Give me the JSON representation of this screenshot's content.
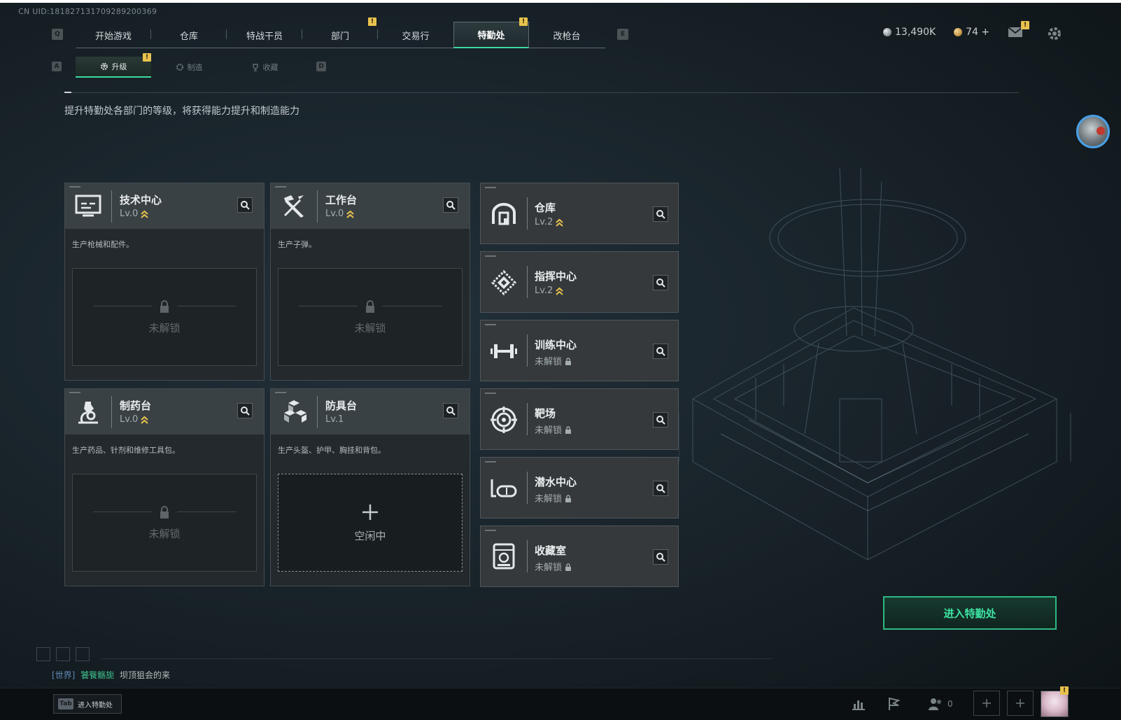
{
  "uid": "CN UID:181827131709289200369",
  "nav": {
    "key_left": "Q",
    "key_right": "E",
    "tabs": [
      "开始游戏",
      "仓库",
      "特战干员",
      "部门",
      "交易行",
      "特勤处",
      "改枪台"
    ],
    "active_tab": "特勤处",
    "alert_tabs": [
      "部门",
      "特勤处"
    ]
  },
  "subnav": {
    "key_left": "A",
    "key_right": "D",
    "tabs": [
      "升级",
      "制造",
      "收藏"
    ],
    "active_tab": "升级"
  },
  "currency": {
    "silver": "13,490K",
    "gold": "74 +",
    "silver_color": "#9aa3a7",
    "gold_color": "#c79a4a"
  },
  "description": "提升特勤处各部门的等级，将获得能力提升和制造能力",
  "facilities_left": [
    {
      "name": "技术中心",
      "level": "Lv.0",
      "upgradable": true,
      "desc": "生产枪械和配件。",
      "slot": "未解锁",
      "icon": "computer-icon"
    },
    {
      "name": "工作台",
      "level": "Lv.0",
      "upgradable": true,
      "desc": "生产子弹。",
      "slot": "未解锁",
      "icon": "tools-icon"
    },
    {
      "name": "制药台",
      "level": "Lv.0",
      "upgradable": true,
      "desc": "生产药品、针剂和维修工具包。",
      "slot": "未解锁",
      "icon": "microscope-icon"
    },
    {
      "name": "防具台",
      "level": "Lv.1",
      "upgradable": false,
      "desc": "生产头盔、护甲、胸挂和背包。",
      "slot": "空闲中",
      "icon": "armor-blocks-icon"
    }
  ],
  "facilities_right": [
    {
      "name": "仓库",
      "level": "Lv.2",
      "locked": false,
      "icon": "warehouse-icon"
    },
    {
      "name": "指挥中心",
      "level": "Lv.2",
      "locked": false,
      "icon": "command-chip-icon"
    },
    {
      "name": "训练中心",
      "level": "未解锁",
      "locked": true,
      "icon": "dumbbell-icon"
    },
    {
      "name": "靶场",
      "level": "未解锁",
      "locked": true,
      "icon": "target-icon"
    },
    {
      "name": "潜水中心",
      "level": "未解锁",
      "locked": true,
      "icon": "diving-mask-icon"
    },
    {
      "name": "收藏室",
      "level": "未解锁",
      "locked": true,
      "icon": "display-case-icon"
    }
  ],
  "enter_button": "进入特勤处",
  "chat": {
    "channel": "[世界]",
    "user": "饕餮觞旎",
    "message": "坝顶狙会的来"
  },
  "bottom": {
    "tab_key": "Tab",
    "tab_label": "进入特勤处",
    "friends_count": "0"
  },
  "alert_mark": "!",
  "accent_color": "#3ddb9e",
  "upgrade_color": "#e8c24e"
}
